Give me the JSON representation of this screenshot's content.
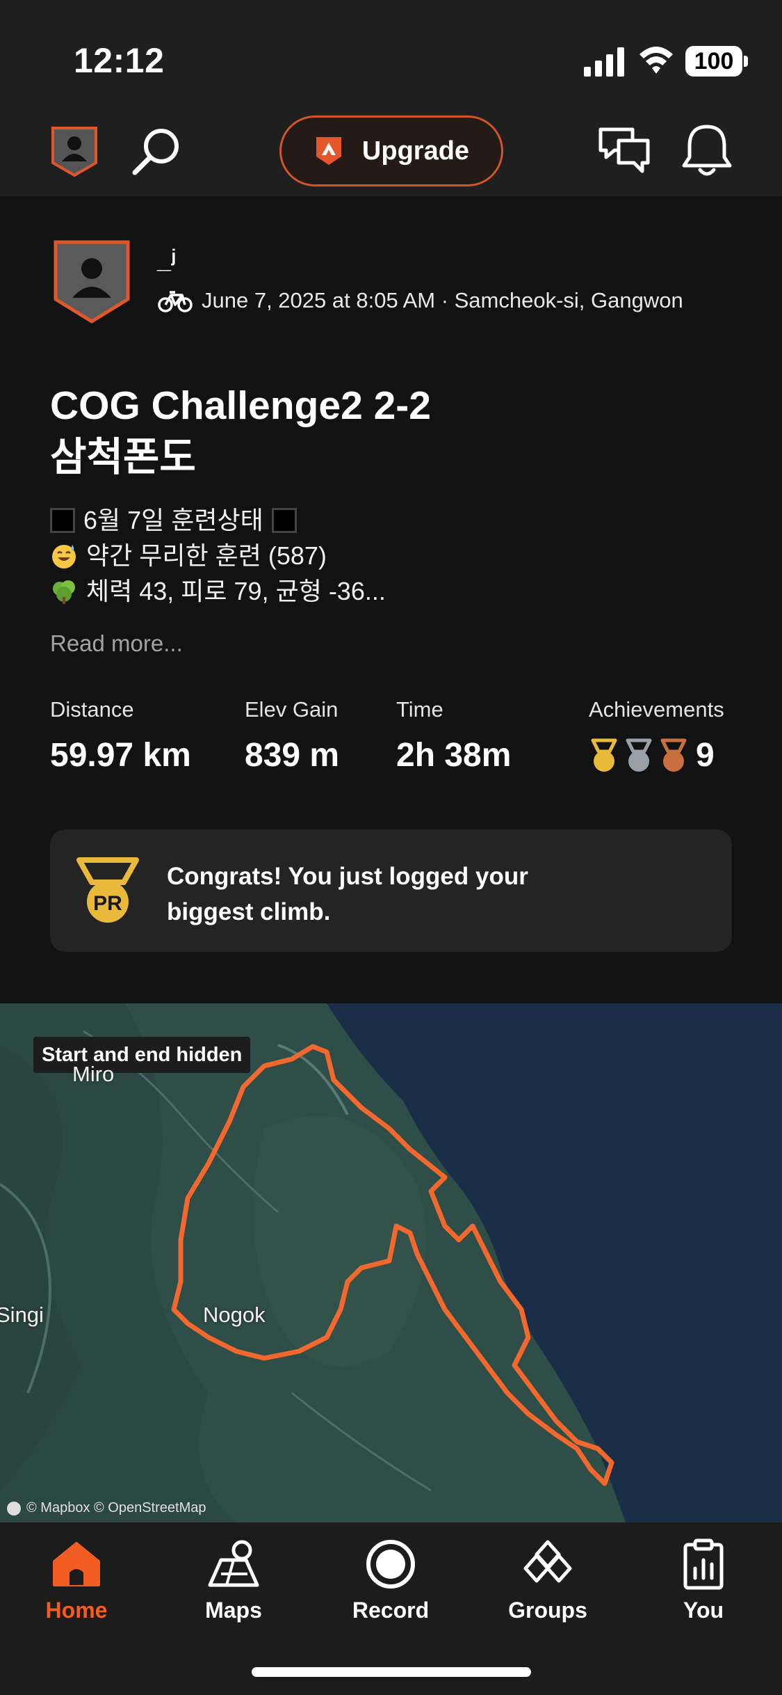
{
  "status_bar": {
    "time": "12:12",
    "battery": "100"
  },
  "header": {
    "upgrade_label": "Upgrade"
  },
  "activity": {
    "user_name": "_ʲ",
    "meta": "June 7, 2025 at 8:05 AM · Samcheok-si, Gangwon",
    "title_line1": "COG Challenge2 2-2",
    "title_line2": "삼척폰도",
    "description": [
      "6월 7일 훈련상태",
      "약간 무리한 훈련 (587)",
      "체력 43, 피로 79, 균형 -36..."
    ],
    "read_more": "Read more...",
    "stats": [
      {
        "label": "Distance",
        "value": "59.97 km"
      },
      {
        "label": "Elev Gain",
        "value": "839 m"
      },
      {
        "label": "Time",
        "value": "2h 38m"
      }
    ],
    "achievements": {
      "label": "Achievements",
      "count": "9",
      "medal_colors": [
        "#e8b93a",
        "#9aa0a6",
        "#c8703f"
      ]
    },
    "pr_card": {
      "text": "Congrats! You just logged your biggest climb.",
      "medal_label": "PR"
    }
  },
  "map": {
    "badge": "Start and end hidden",
    "labels": [
      "Miro",
      "Singi",
      "Nogok"
    ],
    "credit": "© Mapbox © OpenStreetMap",
    "route_color": "#f2682f"
  },
  "nav": [
    {
      "label": "Home",
      "icon": "home-icon",
      "active": true
    },
    {
      "label": "Maps",
      "icon": "maps-icon",
      "active": false
    },
    {
      "label": "Record",
      "icon": "record-icon",
      "active": false
    },
    {
      "label": "Groups",
      "icon": "groups-icon",
      "active": false
    },
    {
      "label": "You",
      "icon": "you-icon",
      "active": false
    }
  ],
  "colors": {
    "accent": "#f25d23",
    "background": "#121212",
    "card": "#242424"
  }
}
